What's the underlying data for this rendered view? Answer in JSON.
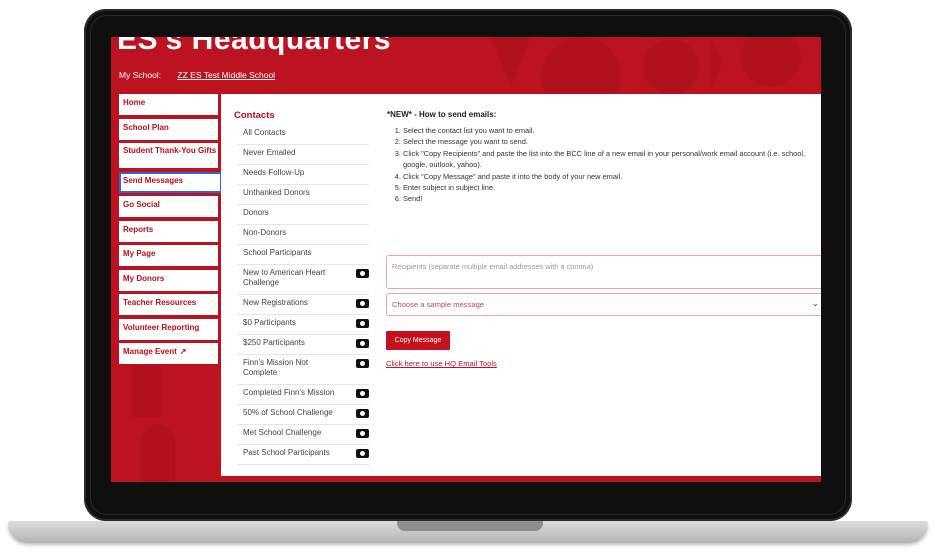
{
  "header": {
    "title": "ES's Headquarters",
    "my_school_label": "My School:",
    "my_school_value": "ZZ ES Test Middle School"
  },
  "sidebar": {
    "items": [
      {
        "label": "Home"
      },
      {
        "label": "School Plan"
      },
      {
        "label": "Student Thank-You Gifts"
      },
      {
        "label": "Send Messages"
      },
      {
        "label": "Go Social"
      },
      {
        "label": "Reports"
      },
      {
        "label": "My Page"
      },
      {
        "label": "My Donors"
      },
      {
        "label": "Teacher Resources"
      },
      {
        "label": "Volunteer Reporting"
      },
      {
        "label": "Manage Event"
      }
    ],
    "active": "Send Messages"
  },
  "contacts": {
    "title": "Contacts",
    "items": [
      {
        "label": "All Contacts",
        "badge": false
      },
      {
        "label": "Never Emailed",
        "badge": false
      },
      {
        "label": "Needs Follow-Up",
        "badge": false
      },
      {
        "label": "Unthanked Donors",
        "badge": false
      },
      {
        "label": "Donors",
        "badge": false
      },
      {
        "label": "Non-Donors",
        "badge": false
      },
      {
        "label": "School Participants",
        "badge": false
      },
      {
        "label": "New to American Heart Challenge",
        "badge": true
      },
      {
        "label": "New Registrations",
        "badge": true
      },
      {
        "label": "$0 Participants",
        "badge": true
      },
      {
        "label": "$250 Participants",
        "badge": true
      },
      {
        "label": "Finn's Mission Not Complete",
        "badge": true
      },
      {
        "label": "Completed Finn's Mission",
        "badge": true
      },
      {
        "label": "50% of School Challenge",
        "badge": true
      },
      {
        "label": "Met School Challenge",
        "badge": true
      },
      {
        "label": "Past School Participants",
        "badge": true
      }
    ]
  },
  "instructions": {
    "title": "*NEW* - How to send emails:",
    "steps": [
      "Select the contact list you want to email.",
      "Select the message you want to send.",
      "Click \"Copy Recipients\" and paste the list into the BCC line of a new email in your personal/work email account (i.e. school, google, outlook, yahoo).",
      "Click \"Copy Message\" and paste it into the body of your new email.",
      "Enter subject in subject line.",
      "Send!"
    ]
  },
  "form": {
    "recipients_placeholder": "Recipients (separate multiple email addresses with a comma)",
    "sample_message_placeholder": "Choose a sample message",
    "copy_message_label": "Copy Message",
    "hq_email_tools_link": "Click here to use HQ Email Tools"
  },
  "colors": {
    "brand_red": "#bd1321",
    "active_outline": "#2f63d8"
  }
}
